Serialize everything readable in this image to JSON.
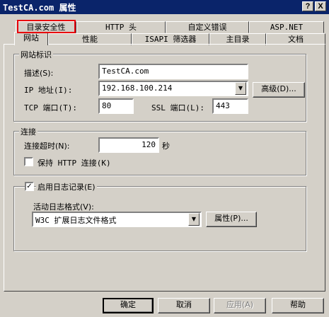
{
  "window": {
    "title": "TestCA.com 属性",
    "help_btn": "?",
    "close_btn": "X"
  },
  "tabs_back": [
    {
      "label": "目录安全性"
    },
    {
      "label": "HTTP 头"
    },
    {
      "label": "自定义错误"
    },
    {
      "label": "ASP.NET"
    }
  ],
  "tabs_front": [
    {
      "label": "网站"
    },
    {
      "label": "性能"
    },
    {
      "label": "ISAPI 筛选器"
    },
    {
      "label": "主目录"
    },
    {
      "label": "文档"
    }
  ],
  "site_id": {
    "group_title": "网站标识",
    "description_label": "描述(S):",
    "description_value": "TestCA.com",
    "ip_label": "IP 地址(I):",
    "ip_value": "192.168.100.214",
    "advanced_button": "高级(D)...",
    "tcp_label": "TCP 端口(T):",
    "tcp_value": "80",
    "ssl_label": "SSL 端口(L):",
    "ssl_value": "443"
  },
  "connection": {
    "group_title": "连接",
    "timeout_label": "连接超时(N):",
    "timeout_value": "120",
    "timeout_unit": "秒",
    "keepalive_label": "保持 HTTP 连接(K)",
    "keepalive_checked": false
  },
  "logging": {
    "enable_label": "启用日志记录(E)",
    "enable_checked": true,
    "format_label": "活动日志格式(V):",
    "format_value": "W3C 扩展日志文件格式",
    "properties_button": "属性(P)..."
  },
  "footer": {
    "ok": "确定",
    "cancel": "取消",
    "apply": "应用(A)",
    "help": "帮助"
  },
  "colors": {
    "titlebar": "#0a246a",
    "face": "#d4d0c8",
    "highlight": "#e8000c"
  }
}
